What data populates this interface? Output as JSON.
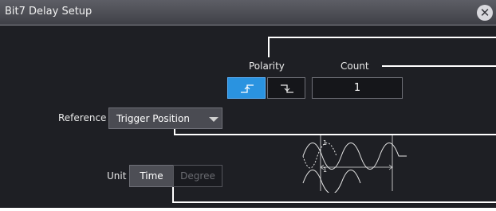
{
  "dialog": {
    "title": "Bit7 Delay Setup",
    "close_icon": "close-icon"
  },
  "polarity": {
    "label": "Polarity",
    "selected": "rising",
    "rising_icon": "rising-edge-icon",
    "falling_icon": "falling-edge-icon"
  },
  "count": {
    "label": "Count",
    "value": "1"
  },
  "reference": {
    "label": "Reference",
    "value": "Trigger Position"
  },
  "unit": {
    "label": "Unit",
    "options": [
      "Time",
      "Degree"
    ],
    "selected": "Time"
  },
  "diagram": {
    "icon": "delay-waveform-diagram",
    "marker_1": "1",
    "marker_2": "1"
  },
  "colors": {
    "accent": "#2a93e0",
    "panel": "#1e1f24",
    "titlebar": "#4a4b52"
  }
}
